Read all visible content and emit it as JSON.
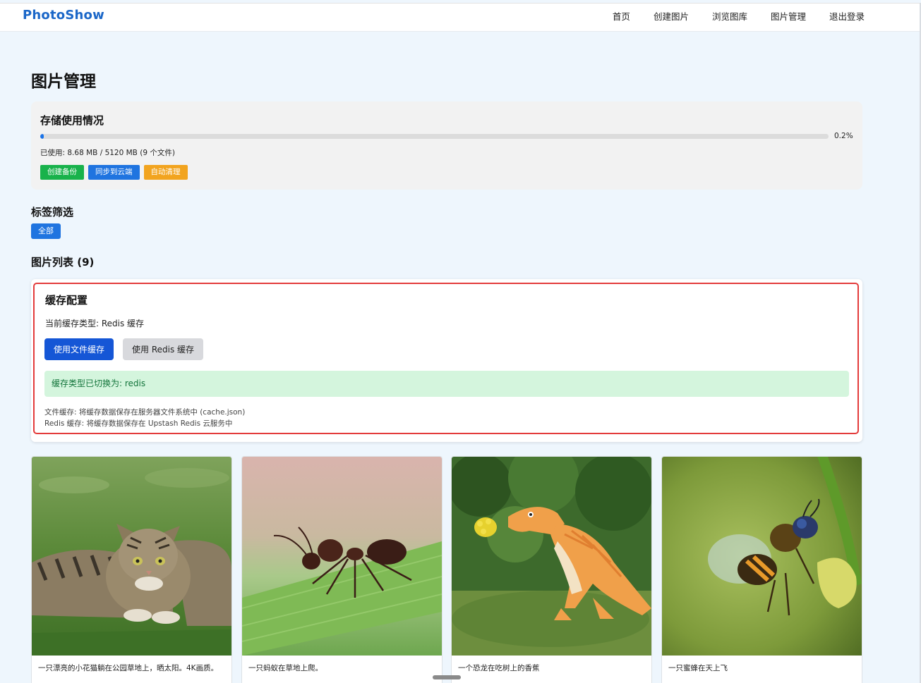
{
  "brand": "PhotoShow",
  "nav": [
    "首页",
    "创建图片",
    "浏览图库",
    "图片管理",
    "退出登录"
  ],
  "page_title": "图片管理",
  "storage": {
    "title": "存储使用情况",
    "percent_label": "0.2%",
    "percent_value": 0.2,
    "usage": "已使用: 8.68 MB / 5120 MB (9 个文件)",
    "buttons": [
      "创建备份",
      "同步到云端",
      "自动清理"
    ]
  },
  "tags": {
    "title": "标签筛选",
    "all": "全部"
  },
  "list_title": "图片列表 (9)",
  "cache": {
    "title": "缓存配置",
    "current": "当前缓存类型: Redis 缓存",
    "file_button": "使用文件缓存",
    "redis_button": "使用 Redis 缓存",
    "message": "缓存类型已切换为: redis",
    "note_file": "文件缓存: 将缓存数据保存在服务器文件系统中 (cache.json)",
    "note_redis": "Redis 缓存: 将缓存数据保存在 Upstash Redis 云服务中"
  },
  "photos": [
    {
      "caption": "一只漂亮的小花猫躺在公园草地上，晒太阳。4K画质。"
    },
    {
      "caption": "一只蚂蚁在草地上爬。"
    },
    {
      "caption": "一个恐龙在吃树上的香蕉"
    },
    {
      "caption": "一只蜜蜂在天上飞"
    }
  ]
}
